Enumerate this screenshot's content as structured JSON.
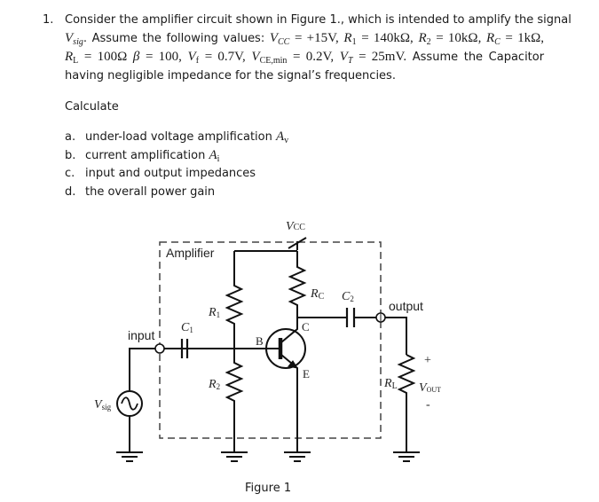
{
  "question": {
    "number": "1.",
    "line1": "Consider the amplifier circuit shown in Figure 1., which is intended to amplify the signal",
    "line2_prefix_symbol": "V",
    "line2_prefix_sub": "sig",
    "line2_text": ". Assume the following values:",
    "params": {
      "vcc": {
        "sym": "V",
        "sub": "CC",
        "val": "= +15V,"
      },
      "r1": {
        "sym": "R",
        "sub": "1",
        "val": "= 140kΩ,"
      },
      "r2": {
        "sym": "R",
        "sub": "2",
        "val": "= 10kΩ,"
      },
      "rc": {
        "sym": "R",
        "sub": "C",
        "val": "= 1kΩ,"
      },
      "rl": {
        "sym": "R",
        "sub": "L",
        "val": "= 100Ω"
      },
      "beta": {
        "sym": "β",
        "val": "= 100,"
      },
      "vf": {
        "sym": "V",
        "sub": "f",
        "val": "= 0.7V,"
      },
      "vcemin": {
        "sym": "V",
        "sub": "CE,min",
        "val": "= 0.2V,"
      },
      "vt": {
        "sym": "V",
        "sub": "T",
        "val": "= 25mV."
      }
    },
    "line3_tail": "Assume the Capacitor",
    "line4": "having negligible impedance for the signal’s frequencies."
  },
  "calculate": {
    "heading": "Calculate",
    "items": [
      {
        "label": "a.",
        "text": "under-load voltage amplification ",
        "sym": "A",
        "sub": "v"
      },
      {
        "label": "b.",
        "text": "current amplification ",
        "sym": "A",
        "sub": "i"
      },
      {
        "label": "c.",
        "text": "input and output impedances"
      },
      {
        "label": "d.",
        "text": "the overall power gain"
      }
    ]
  },
  "figure": {
    "caption": "Figure 1",
    "box_label": "Amplifier",
    "input_label": "input",
    "output_label": "output",
    "vcc": {
      "sym": "V",
      "sub": "CC"
    },
    "r1": {
      "sym": "R",
      "sub": "1"
    },
    "r2": {
      "sym": "R",
      "sub": "2"
    },
    "rc": {
      "sym": "R",
      "sub": "C"
    },
    "rl": {
      "sym": "R",
      "sub": "L"
    },
    "c1": {
      "sym": "C",
      "sub": "1"
    },
    "c2": {
      "sym": "C",
      "sub": "2"
    },
    "vsig": {
      "sym": "V",
      "sub": "sig"
    },
    "vout": {
      "sym": "V",
      "sub": "OUT"
    },
    "base": "B",
    "collector": "C",
    "emitter": "E",
    "plus": "+",
    "minus": "-"
  }
}
